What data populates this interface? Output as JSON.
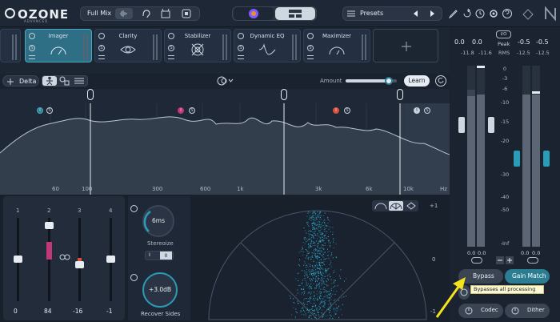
{
  "app": {
    "logo": "OZONE",
    "logo_sub": "ADVANCED"
  },
  "topbar": {
    "full_mix": "Full Mix",
    "presets": "Presets"
  },
  "modules": [
    {
      "name": "Imager",
      "icon": "gauge-icon",
      "active": true
    },
    {
      "name": "Clarity",
      "icon": "eye-icon",
      "active": false
    },
    {
      "name": "Stabilizer",
      "icon": "target-icon",
      "active": false
    },
    {
      "name": "Dynamic EQ",
      "icon": "eq-curve-icon",
      "active": false
    },
    {
      "name": "Maximizer",
      "icon": "gauge-icon",
      "active": false
    }
  ],
  "controls": {
    "delta": "Delta",
    "amount": "Amount",
    "learn": "Learn",
    "amount_value": 0.85
  },
  "band_labels": [
    "I",
    "S",
    "I",
    "S",
    "I",
    "S",
    "I",
    "S"
  ],
  "freq_ticks": [
    "60",
    "100",
    "300",
    "600",
    "1k",
    "3k",
    "6k",
    "10k",
    "Hz"
  ],
  "bands": [
    {
      "label": "1",
      "value": "0",
      "level": 0.5
    },
    {
      "label": "2",
      "value": "84",
      "level": 0.8
    },
    {
      "label": "3",
      "value": "-16",
      "level": 0.45
    },
    {
      "label": "4",
      "value": "-1",
      "level": 0.5
    }
  ],
  "stereoize": {
    "time": "6ms",
    "label": "Stereoize",
    "mode1": "I",
    "mode2": "II"
  },
  "recover": {
    "value": "+3.0dB",
    "label": "Recover Sides"
  },
  "scope_scale": [
    "+1",
    "0",
    "-1"
  ],
  "meters": {
    "peak_l": "0.0",
    "peak_r": "0.0",
    "rms_l": "-11.8",
    "rms_r": "-11.6",
    "peak_label": "Peak",
    "rms_label": "RMS",
    "io": "I/O",
    "out_peak_l": "-0.5",
    "out_peak_r": "-0.5",
    "out_rms_l": "-12.5",
    "out_rms_r": "-12.5",
    "scale": [
      "0",
      "-3",
      "-6",
      "-10",
      "-15",
      "-20",
      "-30",
      "-40",
      "-50",
      "-Inf"
    ],
    "bottom_l": "0.0",
    "bottom_r": "0.0",
    "bottom_out_l": "0.0",
    "bottom_out_r": "0.0"
  },
  "buttons": {
    "bypass": "Bypass",
    "gain_match": "Gain Match",
    "codec": "Codec",
    "dither": "Dither"
  },
  "tooltip": "Bypasses all processing"
}
